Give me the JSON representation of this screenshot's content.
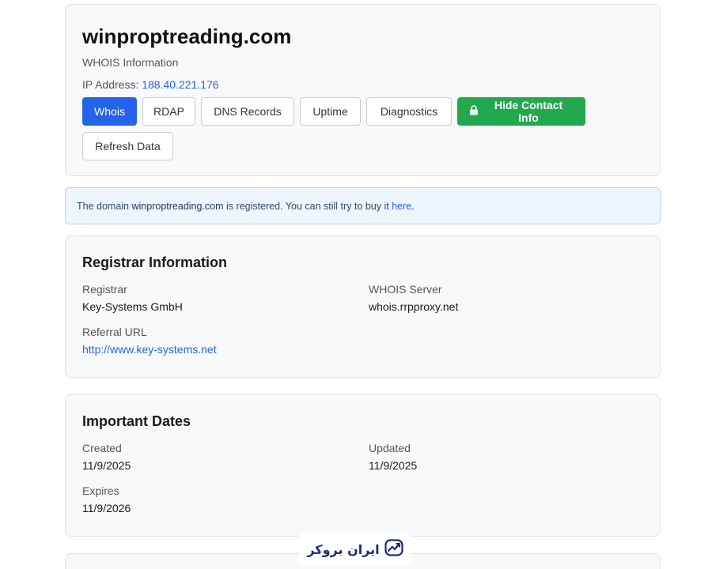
{
  "header": {
    "domain": "winproptreading.com",
    "subtitle": "WHOIS Information",
    "ip_label": "IP Address:",
    "ip_value": "188.40.221.176",
    "buttons": {
      "whois": "Whois",
      "rdap": "RDAP",
      "dns": "DNS Records",
      "uptime": "Uptime",
      "diagnostics": "Diagnostics",
      "hide_contact": "Hide Contact Info",
      "refresh": "Refresh Data"
    }
  },
  "alert": {
    "prefix": "The domain",
    "domain": "winproptreading.com",
    "middle": "is registered. You can still try to buy it",
    "link": "here",
    "suffix": "."
  },
  "registrar": {
    "title": "Registrar Information",
    "registrar_label": "Registrar",
    "registrar_value": "Key-Systems GmbH",
    "whois_server_label": "WHOIS Server",
    "whois_server_value": "whois.rrpproxy.net",
    "referral_label": "Referral URL",
    "referral_value": "http://www.key-systems.net"
  },
  "dates": {
    "title": "Important Dates",
    "created_label": "Created",
    "created_value": "11/9/2025",
    "updated_label": "Updated",
    "updated_value": "11/9/2025",
    "expires_label": "Expires",
    "expires_value": "11/9/2026"
  },
  "watermark": {
    "text": "ایران بروکر",
    "icon": "trend-chart-icon"
  },
  "colors": {
    "primary": "#2563eb",
    "success": "#22a94d",
    "alert_bg": "#edf5fd"
  }
}
